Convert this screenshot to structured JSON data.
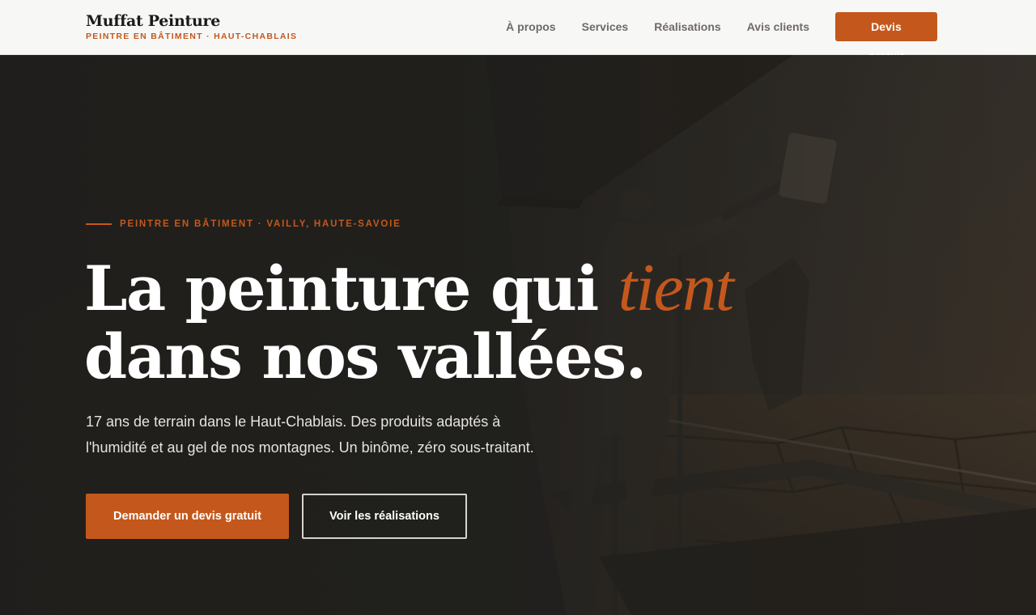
{
  "header": {
    "brand_name": "Muffat Peinture",
    "brand_tagline": "PEINTRE EN BÂTIMENT · HAUT-CHABLAIS",
    "nav": [
      {
        "label": "À propos"
      },
      {
        "label": "Services"
      },
      {
        "label": "Réalisations"
      },
      {
        "label": "Avis clients"
      }
    ],
    "cta_label": "Devis gratuit"
  },
  "hero": {
    "eyebrow": "PEINTRE EN BÂTIMENT · VAILLY, HAUTE-SAVOIE",
    "headline_part1": "La peinture qui ",
    "headline_accent": "tient",
    "headline_part2": "dans nos vallées.",
    "lead": "17 ans de terrain dans le Haut-Chablais. Des produits adaptés à l'humidité et au gel de nos montagnes. Un binôme, zéro sous-traitant.",
    "primary_button": "Demander un devis gratuit",
    "secondary_button": "Voir les réalisations"
  },
  "colors": {
    "accent": "#c4581c",
    "header_bg": "#f7f7f6",
    "hero_overlay": "#1f1e1c"
  },
  "hero_image": {
    "icon_name": "painter-on-scaffold-photo"
  }
}
